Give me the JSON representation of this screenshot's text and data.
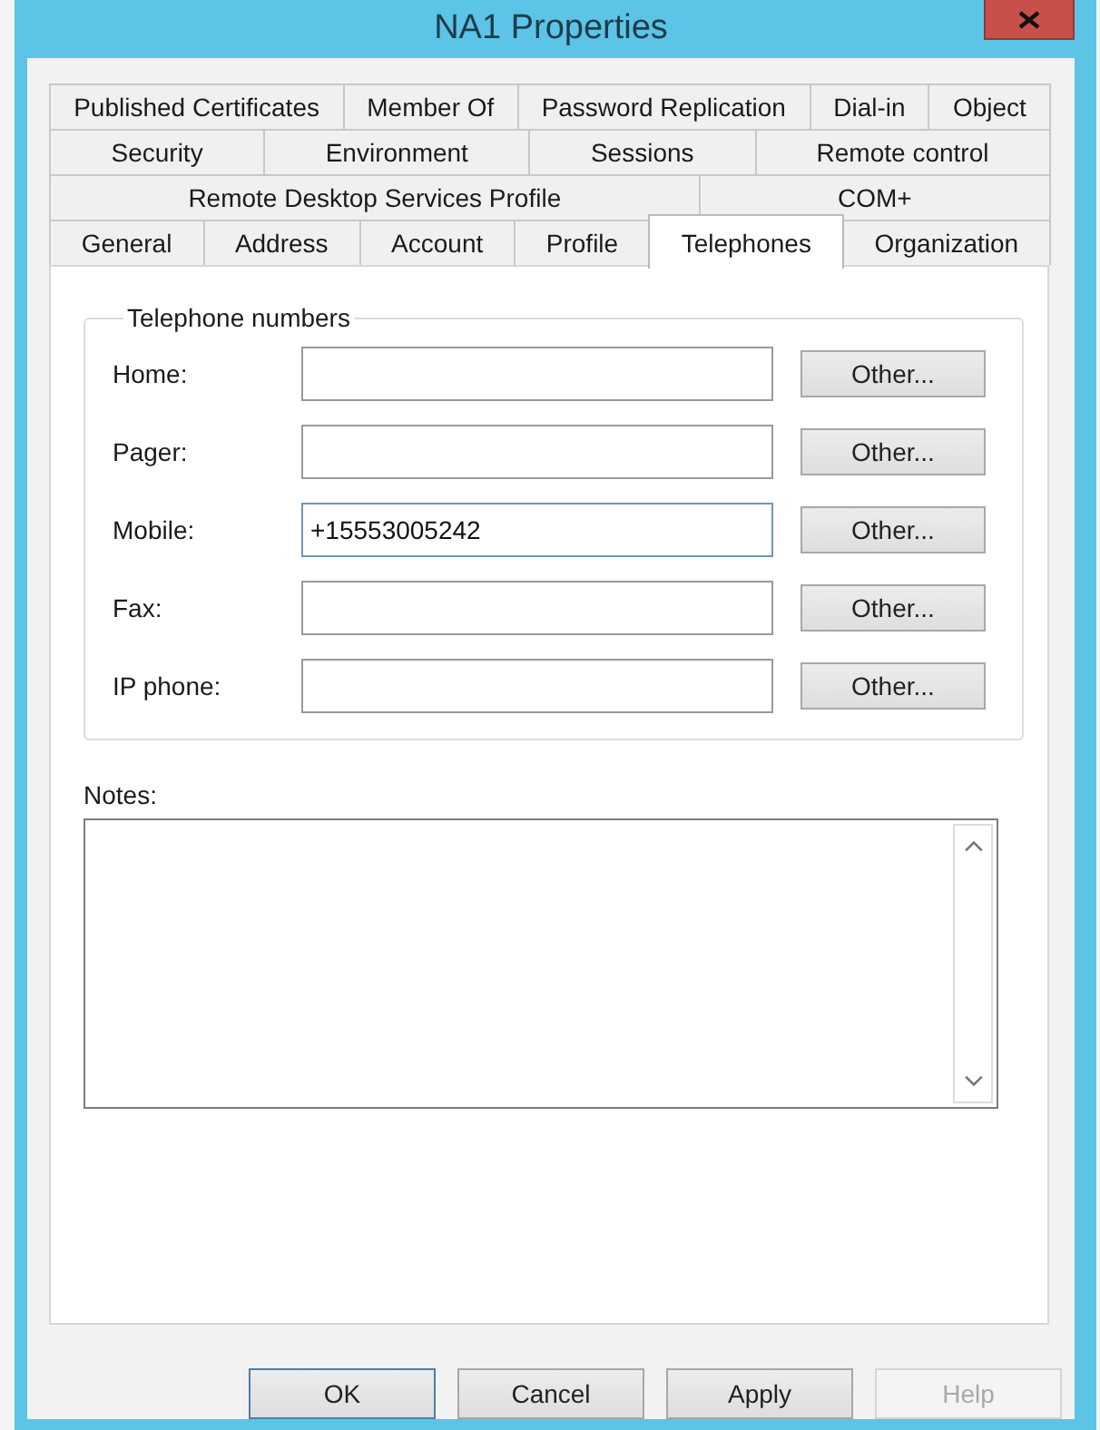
{
  "window": {
    "title": "NA1 Properties"
  },
  "tab_rows": [
    [
      {
        "label": "Published Certificates",
        "selected": false
      },
      {
        "label": "Member Of",
        "selected": false
      },
      {
        "label": "Password Replication",
        "selected": false
      },
      {
        "label": "Dial-in",
        "selected": false
      },
      {
        "label": "Object",
        "selected": false
      }
    ],
    [
      {
        "label": "Security",
        "selected": false
      },
      {
        "label": "Environment",
        "selected": false
      },
      {
        "label": "Sessions",
        "selected": false
      },
      {
        "label": "Remote control",
        "selected": false
      }
    ],
    [
      {
        "label": "Remote Desktop Services Profile",
        "selected": false
      },
      {
        "label": "COM+",
        "selected": false
      }
    ],
    [
      {
        "label": "General",
        "selected": false
      },
      {
        "label": "Address",
        "selected": false
      },
      {
        "label": "Account",
        "selected": false
      },
      {
        "label": "Profile",
        "selected": false
      },
      {
        "label": "Telephones",
        "selected": true
      },
      {
        "label": "Organization",
        "selected": false
      }
    ]
  ],
  "telephone_numbers": {
    "title": "Telephone numbers",
    "rows": [
      {
        "label": "Home:",
        "button": "Other...",
        "focused": false
      },
      {
        "label": "Pager:",
        "button": "Other...",
        "focused": false
      },
      {
        "label": "Mobile:",
        "value": "+15553005242",
        "button": "Other...",
        "focused": true
      },
      {
        "label": "Fax:",
        "button": "Other...",
        "focused": false
      },
      {
        "label": "IP phone:",
        "button": "Other...",
        "focused": false
      }
    ]
  },
  "notes": {
    "label": "Notes:"
  },
  "buttons": [
    {
      "label": "OK",
      "disabled": false,
      "default": true
    },
    {
      "label": "Cancel",
      "disabled": false,
      "default": false
    },
    {
      "label": "Apply",
      "disabled": false,
      "default": false
    },
    {
      "label": "Help",
      "disabled": true,
      "default": false
    }
  ]
}
